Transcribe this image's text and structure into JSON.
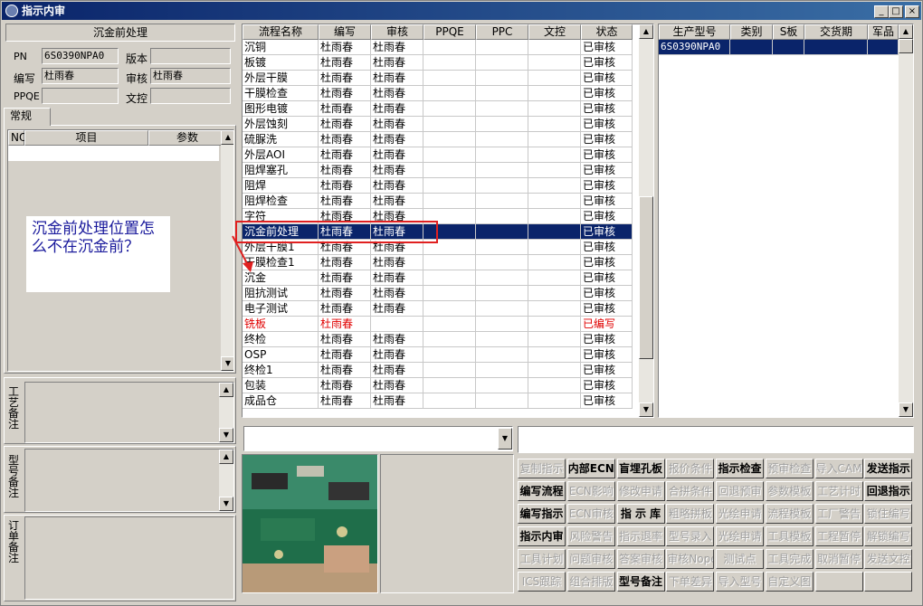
{
  "window": {
    "title": "指示内审",
    "min": "_",
    "max": "□",
    "close": "×"
  },
  "left": {
    "section_title": "沉金前处理",
    "fields": {
      "pn_label": "PN",
      "pn_value": "6S0390NPA0",
      "version_label": "版本",
      "version_value": "",
      "writer_label": "编写",
      "writer_value": "杜雨春",
      "reviewer_label": "审核",
      "reviewer_value": "杜雨春",
      "ppqe_label": "PPQE",
      "ppqe_value": "",
      "doc_label": "文控",
      "doc_value": ""
    },
    "tab": "常规",
    "param_table": {
      "headers": [
        "NO",
        "项目",
        "参数"
      ]
    },
    "annotation": "沉金前处理位置怎么不在沉金前？",
    "memos": [
      "工艺备注",
      "型号备注",
      "订单备注"
    ]
  },
  "flow_table": {
    "headers": [
      "流程名称",
      "编写",
      "审核",
      "PPQE",
      "PPC",
      "文控",
      "状态"
    ],
    "rows": [
      {
        "name": "沉铜",
        "writer": "杜雨春",
        "reviewer": "杜雨春",
        "status": "已审核"
      },
      {
        "name": "板镀",
        "writer": "杜雨春",
        "reviewer": "杜雨春",
        "status": "已审核"
      },
      {
        "name": "外层干膜",
        "writer": "杜雨春",
        "reviewer": "杜雨春",
        "status": "已审核"
      },
      {
        "name": "干膜检查",
        "writer": "杜雨春",
        "reviewer": "杜雨春",
        "status": "已审核"
      },
      {
        "name": "图形电镀",
        "writer": "杜雨春",
        "reviewer": "杜雨春",
        "status": "已审核"
      },
      {
        "name": "外层蚀刻",
        "writer": "杜雨春",
        "reviewer": "杜雨春",
        "status": "已审核"
      },
      {
        "name": "硫脲洗",
        "writer": "杜雨春",
        "reviewer": "杜雨春",
        "status": "已审核"
      },
      {
        "name": "外层AOI",
        "writer": "杜雨春",
        "reviewer": "杜雨春",
        "status": "已审核"
      },
      {
        "name": "阻焊塞孔",
        "writer": "杜雨春",
        "reviewer": "杜雨春",
        "status": "已审核"
      },
      {
        "name": "阻焊",
        "writer": "杜雨春",
        "reviewer": "杜雨春",
        "status": "已审核"
      },
      {
        "name": "阻焊检查",
        "writer": "杜雨春",
        "reviewer": "杜雨春",
        "status": "已审核"
      },
      {
        "name": "字符",
        "writer": "杜雨春",
        "reviewer": "杜雨春",
        "status": "已审核"
      },
      {
        "name": "沉金前处理",
        "writer": "杜雨春",
        "reviewer": "杜雨春",
        "status": "已审核"
      },
      {
        "name": "外层干膜1",
        "writer": "杜雨春",
        "reviewer": "杜雨春",
        "status": "已审核"
      },
      {
        "name": "干膜检查1",
        "writer": "杜雨春",
        "reviewer": "杜雨春",
        "status": "已审核"
      },
      {
        "name": "沉金",
        "writer": "杜雨春",
        "reviewer": "杜雨春",
        "status": "已审核"
      },
      {
        "name": "阻抗测试",
        "writer": "杜雨春",
        "reviewer": "杜雨春",
        "status": "已审核"
      },
      {
        "name": "电子测试",
        "writer": "杜雨春",
        "reviewer": "杜雨春",
        "status": "已审核"
      },
      {
        "name": "铣板",
        "writer": "杜雨春",
        "reviewer": "",
        "status": "已编写"
      },
      {
        "name": "终检",
        "writer": "杜雨春",
        "reviewer": "杜雨春",
        "status": "已审核"
      },
      {
        "name": "OSP",
        "writer": "杜雨春",
        "reviewer": "杜雨春",
        "status": "已审核"
      },
      {
        "name": "终检1",
        "writer": "杜雨春",
        "reviewer": "杜雨春",
        "status": "已审核"
      },
      {
        "name": "包装",
        "writer": "杜雨春",
        "reviewer": "杜雨春",
        "status": "已审核"
      },
      {
        "name": "成品仓",
        "writer": "杜雨春",
        "reviewer": "杜雨春",
        "status": "已审核"
      }
    ]
  },
  "model_table": {
    "headers": [
      "生产型号",
      "类别",
      "S板",
      "交货期",
      "军品"
    ],
    "rows": [
      {
        "model": "6S0390NPA0",
        "category": "",
        "s": "",
        "date": "",
        "mil": ""
      }
    ]
  },
  "buttons": [
    [
      "复制指示",
      "内部ECN",
      "盲埋孔板",
      "报价条件",
      "指示检查",
      "预审检查",
      "导入CAM",
      "发送指示"
    ],
    [
      "编写流程",
      "ECN影响",
      "修改申请",
      "合拼条件",
      "回退预审",
      "参数模板",
      "工艺计时",
      "回退指示"
    ],
    [
      "编写指示",
      "ECN审核",
      "指 示 库",
      "粗略拼板",
      "光绘申请",
      "流程模板",
      "工厂警告",
      "锁住编写"
    ],
    [
      "指示内审",
      "风险警告",
      "指示退率",
      "型号录入",
      "光绘申请",
      "工具模板",
      "工程暂停",
      "解锁编写"
    ],
    [
      "工具计划",
      "问题审核",
      "答案审核",
      "审核Nope",
      "测试点",
      "工具完成",
      "取消暂停",
      "发送文控"
    ],
    [
      "ICS跟踪",
      "组合排版",
      "型号备注",
      "下单差异",
      "导入型号",
      "自定义图",
      "",
      ""
    ]
  ],
  "button_enabled": [
    [
      false,
      true,
      true,
      false,
      true,
      false,
      false,
      true
    ],
    [
      true,
      false,
      false,
      false,
      false,
      false,
      false,
      true
    ],
    [
      true,
      false,
      true,
      false,
      false,
      false,
      false,
      false
    ],
    [
      true,
      false,
      false,
      false,
      false,
      false,
      false,
      false
    ],
    [
      false,
      false,
      false,
      false,
      false,
      false,
      false,
      false
    ],
    [
      false,
      false,
      true,
      false,
      false,
      false,
      false,
      false
    ]
  ],
  "colors": {
    "selection": "#0a246a",
    "annotation_red": "#e02020",
    "annotation_blue": "#1a1a9c",
    "warn_red": "#e00000"
  }
}
